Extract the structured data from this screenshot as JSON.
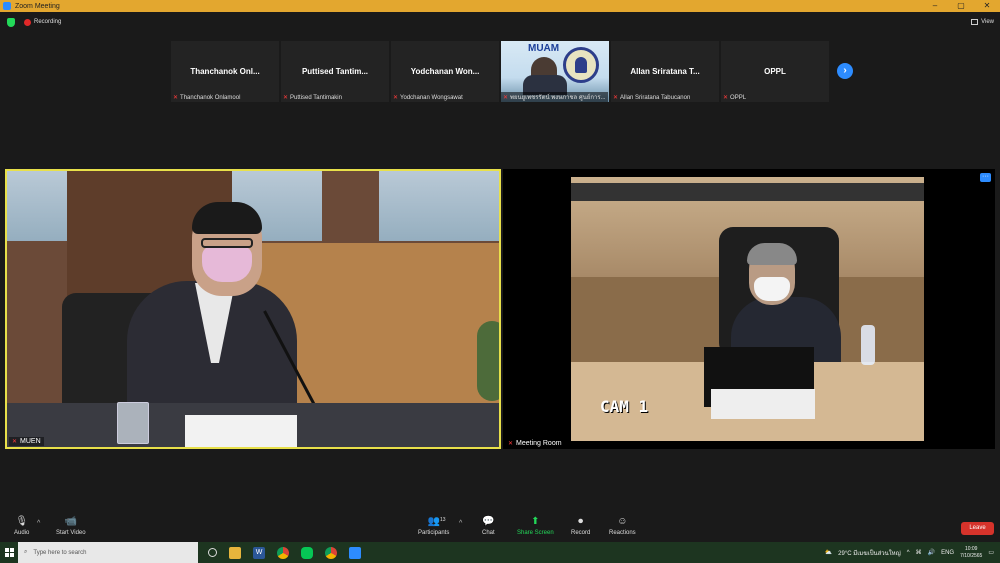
{
  "window": {
    "title": "Zoom Meeting",
    "min": "–",
    "max": "▢",
    "close": "✕"
  },
  "topbar": {
    "recording_label": "Recording",
    "view_label": "View"
  },
  "thumbnails": [
    {
      "display_name": "Thanchanok Onl...",
      "label": "Thanchanok Onlamool"
    },
    {
      "display_name": "Puttised Tantim...",
      "label": "Puttised Tantimakin"
    },
    {
      "display_name": "Yodchanan Won...",
      "label": "Yodchanan Wongsawat"
    },
    {
      "display_name": "",
      "label": "พยนยูเพชรรัตน์ พงษภาชล ศูนย์การ...",
      "logo_text": "MUAM"
    },
    {
      "display_name": "Allan Sriratana T...",
      "label": "Allan Sriratana Tabucanon"
    },
    {
      "display_name": "OPPL",
      "label": "OPPL"
    }
  ],
  "main_left": {
    "label": "MUEN"
  },
  "main_right": {
    "label": "Meeting Room",
    "cam_text": "CAM 1"
  },
  "controls": {
    "audio": "Audio",
    "start_video": "Start Video",
    "participants": "Participants",
    "participants_count": "13",
    "chat": "Chat",
    "share_screen": "Share Screen",
    "record": "Record",
    "reactions": "Reactions",
    "leave": "Leave"
  },
  "taskbar": {
    "search_placeholder": "Type here to search",
    "weather": "29°C มีเมฆเป็นส่วนใหญ่",
    "lang": "ENG",
    "time": "10:09",
    "date": "7/10/2565"
  },
  "colors": {
    "accent": "#2d8cff",
    "title_bar": "#e3a72f",
    "active_speaker": "#e8e04a",
    "leave": "#d6332b",
    "share": "#23d959"
  }
}
